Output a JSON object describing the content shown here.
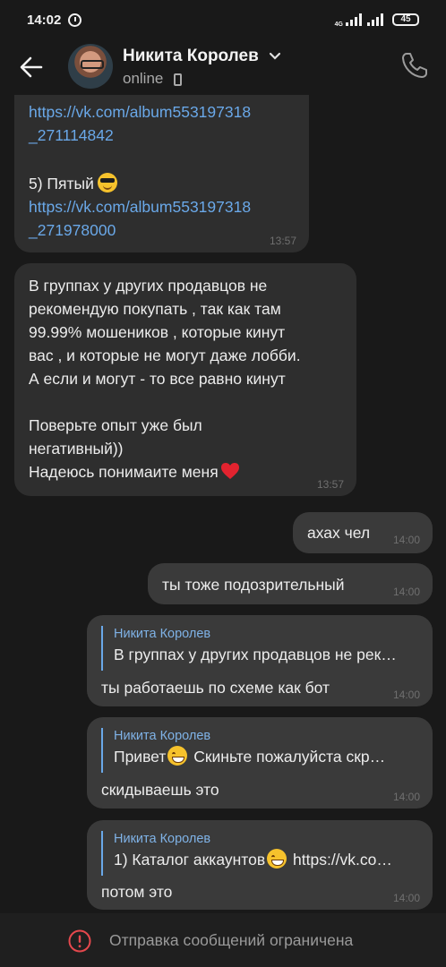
{
  "status_bar": {
    "time": "14:02",
    "network": "4G",
    "battery": "45"
  },
  "header": {
    "contact_name": "Никита Королев",
    "status": "online"
  },
  "messages": [
    {
      "direction": "incoming",
      "link1_line1": "https://vk.com/album553197318",
      "link1_line2": "_271114842",
      "item_label": "5) Пятый",
      "link2_line1": "https://vk.com/album553197318",
      "link2_line2": "_271978000",
      "time": "13:57"
    },
    {
      "direction": "incoming",
      "lines": [
        "В группах у других продавцов не",
        "рекомендую покупать , так как там",
        "99.99% мошеников , которые кинут",
        "вас , и которые не могут даже лобби.",
        "А если и могут - то все равно кинут",
        "",
        "Поверьте опыт уже был",
        "негативный))",
        "Надеюсь понимаите меня"
      ],
      "time": "13:57"
    },
    {
      "direction": "outgoing",
      "text": "ахах чел",
      "time": "14:00"
    },
    {
      "direction": "outgoing",
      "text": "ты тоже подозрительный",
      "time": "14:00"
    },
    {
      "direction": "outgoing",
      "reply_author": "Никита Королев",
      "reply_text": "В группах у других продавцов не рек…",
      "text": "ты работаешь по схеме как бот",
      "time": "14:00"
    },
    {
      "direction": "outgoing",
      "reply_author": "Никита Королев",
      "reply_text_a": "Привет",
      "reply_text_b": "Скиньте пожалуйста скр…",
      "text": "скидываешь это",
      "time": "14:00"
    },
    {
      "direction": "outgoing",
      "reply_author": "Никита Королев",
      "reply_text_a": "1) Каталог аккаунтов",
      "reply_text_b": "https://vk.co…",
      "text": "потом это",
      "time": "14:00"
    }
  ],
  "footer": {
    "notice": "Отправка сообщений ограничена"
  },
  "colors": {
    "background": "#191919",
    "bubble_incoming": "#2e2e2e",
    "bubble_outgoing": "#3a3a3a",
    "link": "#6aa8e8",
    "warning": "#e5484d"
  }
}
